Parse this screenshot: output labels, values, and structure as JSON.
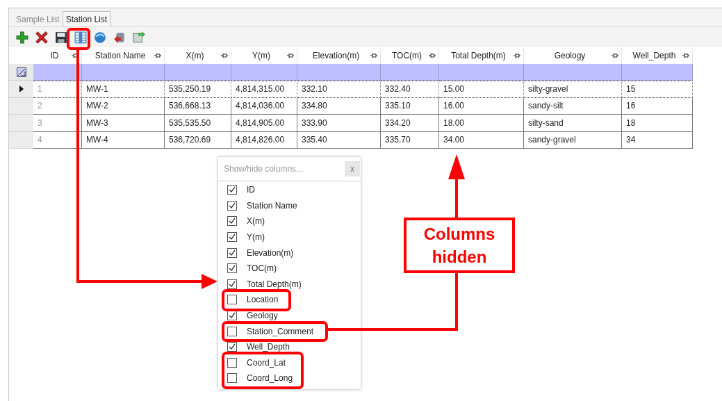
{
  "tabs": [
    {
      "label": "Sample List",
      "selected": false
    },
    {
      "label": "Station List",
      "selected": true
    }
  ],
  "toolbar": [
    {
      "kind": "add"
    },
    {
      "kind": "delete"
    },
    {
      "kind": "save"
    },
    {
      "kind": "columns"
    },
    {
      "kind": "refresh"
    },
    {
      "kind": "import"
    },
    {
      "kind": "export"
    }
  ],
  "table": {
    "columns": [
      "ID",
      "Station Name",
      "X(m)",
      "Y(m)",
      "Elevation(m)",
      "TOC(m)",
      "Total Depth(m)",
      "Geology",
      "Well_Depth"
    ],
    "rows": [
      {
        "selected": true,
        "cells": [
          "1",
          "MW-1",
          "535,250.19",
          "4,814,315.00",
          "332.10",
          "332.40",
          "15.00",
          "silty-gravel",
          "15"
        ]
      },
      {
        "selected": false,
        "cells": [
          "2",
          "MW-2",
          "536,668.13",
          "4,814,036.00",
          "334.80",
          "335.10",
          "16.00",
          "sandy-silt",
          "16"
        ]
      },
      {
        "selected": false,
        "cells": [
          "3",
          "MW-3",
          "535,535.50",
          "4,814,905.00",
          "333.90",
          "334.20",
          "18.00",
          "silty-sand",
          "18"
        ]
      },
      {
        "selected": false,
        "cells": [
          "4",
          "MW-4",
          "536,720.69",
          "4,814,826.00",
          "335.40",
          "335.70",
          "34.00",
          "sandy-gravel",
          "34"
        ]
      }
    ]
  },
  "column_chooser": {
    "title": "Show/hide columns...",
    "close": "x",
    "items": [
      {
        "label": "ID",
        "checked": true
      },
      {
        "label": "Station Name",
        "checked": true
      },
      {
        "label": "X(m)",
        "checked": true
      },
      {
        "label": "Y(m)",
        "checked": true
      },
      {
        "label": "Elevation(m)",
        "checked": true
      },
      {
        "label": "TOC(m)",
        "checked": true
      },
      {
        "label": "Total Depth(m)",
        "checked": true
      },
      {
        "label": "Location",
        "checked": false
      },
      {
        "label": "Geology",
        "checked": true
      },
      {
        "label": "Station_Comment",
        "checked": false
      },
      {
        "label": "Well_Depth",
        "checked": true
      },
      {
        "label": "Coord_Lat",
        "checked": false
      },
      {
        "label": "Coord_Long",
        "checked": false
      }
    ]
  },
  "callout": "Columns hidden"
}
